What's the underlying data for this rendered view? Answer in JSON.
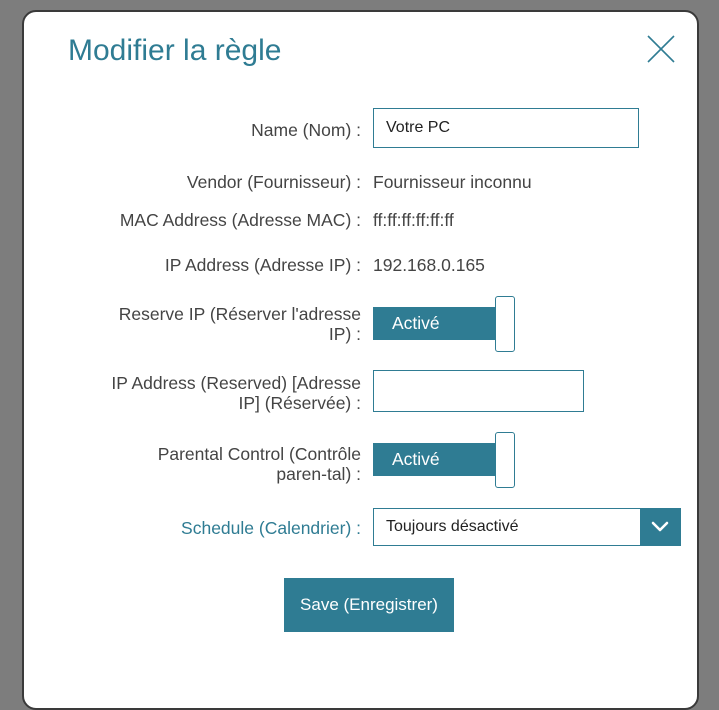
{
  "dialog": {
    "title": "Modifier la règle",
    "close_icon": "close-icon"
  },
  "form": {
    "name": {
      "label": "Name (Nom) :",
      "value": "Votre PC"
    },
    "vendor": {
      "label": "Vendor (Fournisseur) :",
      "value": "Fournisseur inconnu"
    },
    "mac": {
      "label": "MAC Address (Adresse MAC) :",
      "value": "ff:ff:ff:ff:ff:ff"
    },
    "ip": {
      "label": "IP Address (Adresse IP) :",
      "value": "192.168.0.165"
    },
    "reserve_ip": {
      "label": "Reserve IP (Réserver l'adresse IP) :",
      "state": "Activé"
    },
    "ip_reserved": {
      "label": "IP Address (Reserved) [Adresse IP] (Réservée) :",
      "value": ""
    },
    "parental_control": {
      "label": "Parental Control (Contrôle paren-tal) :",
      "state": "Activé"
    },
    "schedule": {
      "label": "Schedule (Calendrier) :",
      "selected": "Toujours désactivé",
      "icon": "chevron-down-icon"
    }
  },
  "actions": {
    "save_label": "Save (Enregistrer)"
  },
  "colors": {
    "accent": "#2f7c93",
    "text": "#444444",
    "backdrop": "#7d7d7d"
  }
}
